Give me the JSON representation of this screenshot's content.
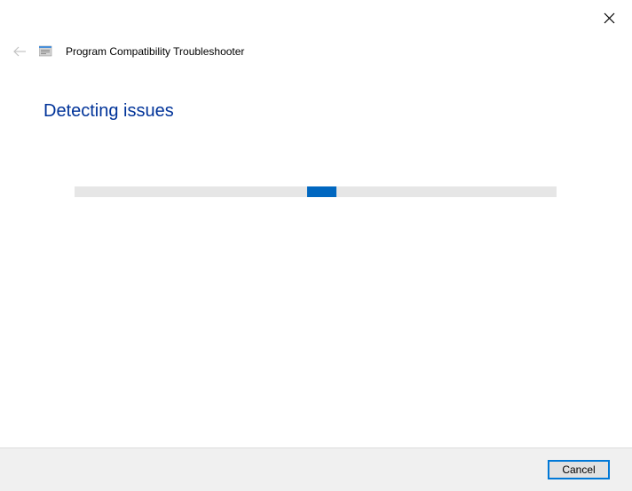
{
  "window": {
    "title": "Program Compatibility Troubleshooter"
  },
  "main": {
    "heading": "Detecting issues"
  },
  "footer": {
    "cancel_label": "Cancel"
  }
}
